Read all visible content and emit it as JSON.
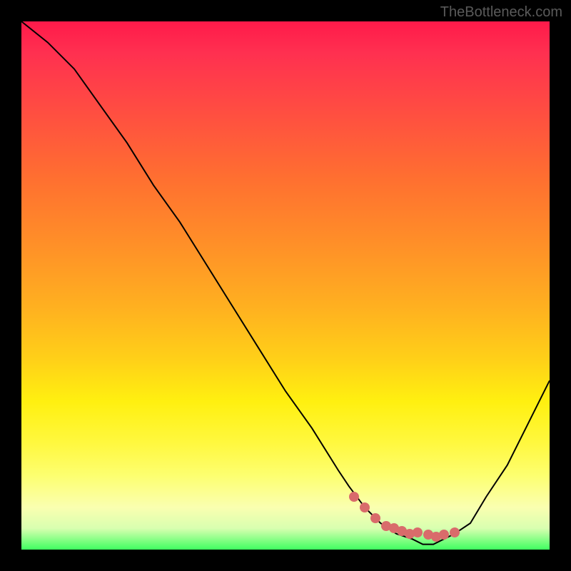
{
  "watermark": "TheBottleneck.com",
  "chart_data": {
    "type": "line",
    "title": "",
    "xlabel": "",
    "ylabel": "",
    "xlim": [
      0,
      100
    ],
    "ylim": [
      0,
      100
    ],
    "series": [
      {
        "name": "bottleneck-curve",
        "x": [
          0,
          5,
          10,
          15,
          20,
          25,
          30,
          35,
          40,
          45,
          50,
          55,
          60,
          62,
          65,
          68,
          71,
          74,
          76,
          78,
          80,
          82,
          85,
          88,
          92,
          96,
          100
        ],
        "values": [
          100,
          96,
          91,
          84,
          77,
          69,
          62,
          54,
          46,
          38,
          30,
          23,
          15,
          12,
          8,
          5,
          3,
          2,
          1,
          1,
          2,
          3,
          5,
          10,
          16,
          24,
          32
        ]
      }
    ],
    "marker_cluster": {
      "x": [
        63,
        65,
        67,
        69,
        70.5,
        72,
        73.5,
        75,
        77,
        78.5,
        80,
        82
      ],
      "values": [
        10,
        8,
        6,
        4.5,
        4,
        3.5,
        3,
        3.2,
        2.8,
        2.5,
        2.8,
        3.3
      ]
    },
    "colors": {
      "curve": "#000000",
      "marker": "#d96b6b",
      "gradient_top": "#ff1a4a",
      "gradient_bottom": "#40ff60"
    }
  }
}
